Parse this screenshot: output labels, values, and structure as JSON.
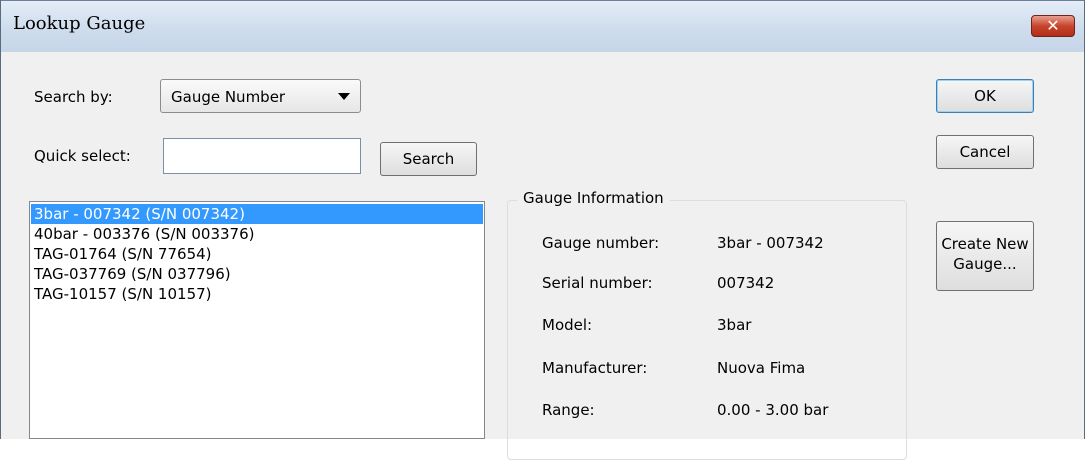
{
  "window": {
    "title": "Lookup Gauge",
    "close_symbol": "✕"
  },
  "search_by": {
    "label": "Search by:",
    "selected": "Gauge Number"
  },
  "quick_select": {
    "label": "Quick select:",
    "value": "",
    "button": "Search"
  },
  "gauges": [
    "3bar - 007342 (S/N 007342)",
    "40bar - 003376 (S/N 003376)",
    "TAG-01764 (S/N 77654)",
    "TAG-037769 (S/N 037796)",
    "TAG-10157 (S/N 10157)"
  ],
  "selected_index": 0,
  "gauge_info": {
    "title": "Gauge Information",
    "gauge_number_label": "Gauge number:",
    "gauge_number": "3bar - 007342",
    "serial_label": "Serial number:",
    "serial": "007342",
    "model_label": "Model:",
    "model": "3bar",
    "manufacturer_label": "Manufacturer:",
    "manufacturer": "Nuova Fima",
    "range_label": "Range:",
    "range": "0.00 - 3.00 bar"
  },
  "buttons": {
    "ok": "OK",
    "cancel": "Cancel",
    "create_line1": "Create New",
    "create_line2": "Gauge..."
  },
  "colors": {
    "selection": "#3399ff",
    "close": "#c8442c"
  },
  "icons": {
    "dropdown": "chevron-down-icon",
    "close": "close-icon"
  }
}
